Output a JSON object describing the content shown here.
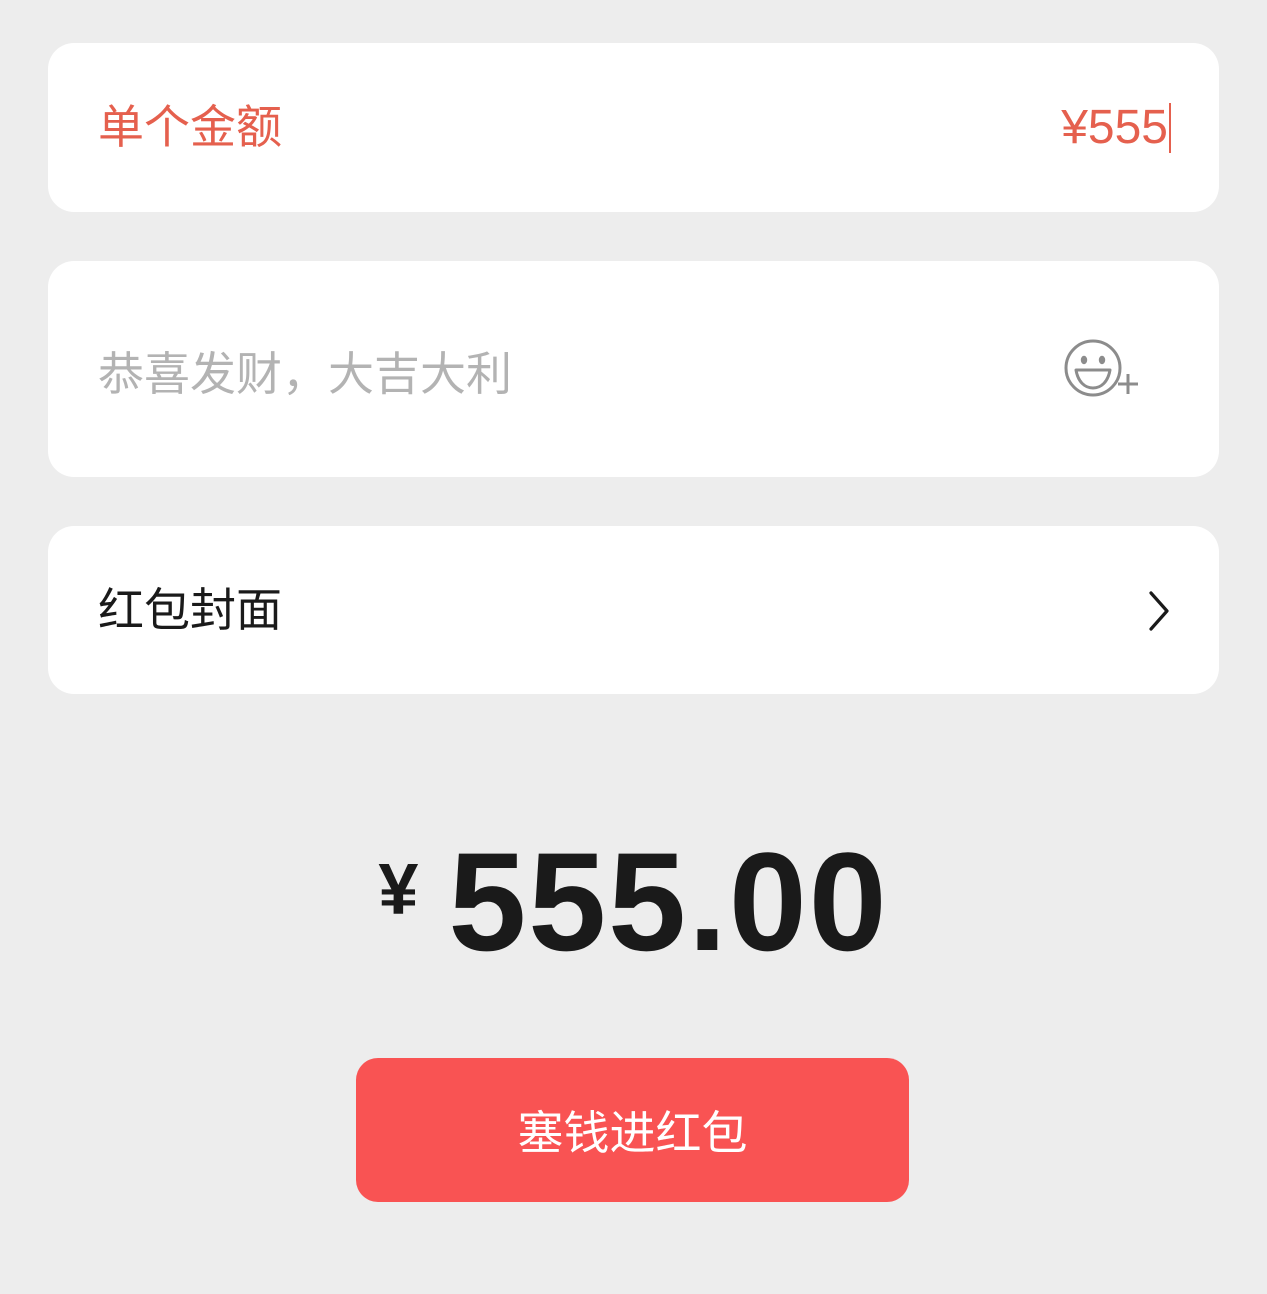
{
  "amount_card": {
    "label": "单个金额",
    "value": "¥555"
  },
  "greeting_card": {
    "placeholder": "恭喜发财，大吉大利",
    "emoji_icon": "emoji-add-icon"
  },
  "cover_card": {
    "label": "红包封面",
    "arrow_icon": "chevron-right-icon"
  },
  "total": {
    "currency": "¥",
    "amount": "555.00"
  },
  "submit": {
    "label": "塞钱进红包"
  },
  "colors": {
    "background": "#ededed",
    "accent_text": "#e5604e",
    "button": "#f95353",
    "placeholder": "#b3b3b3"
  }
}
